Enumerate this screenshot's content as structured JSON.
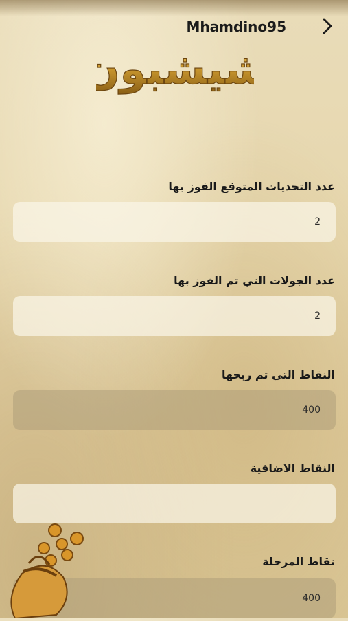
{
  "header": {
    "username": "Mhamdino95",
    "back_icon": "chevron-right-icon"
  },
  "logo": {
    "text": "شيشبون",
    "color": "#c8962e"
  },
  "fields": [
    {
      "label": "عدد التحديات المتوقع الفوز بها",
      "value": "2",
      "style": "light"
    },
    {
      "label": "عدد الجولات التي تم الفوز بها",
      "value": "2",
      "style": "light"
    },
    {
      "label": "النقاط التي تم ربحها",
      "value": "400",
      "style": "dark"
    },
    {
      "label": "النقاط الاضافية",
      "value": "",
      "style": "light"
    },
    {
      "label": "نقاط المرحلة",
      "value": "400",
      "style": "dark"
    }
  ],
  "decor": {
    "coins_icon": "coin-bag-icon"
  }
}
